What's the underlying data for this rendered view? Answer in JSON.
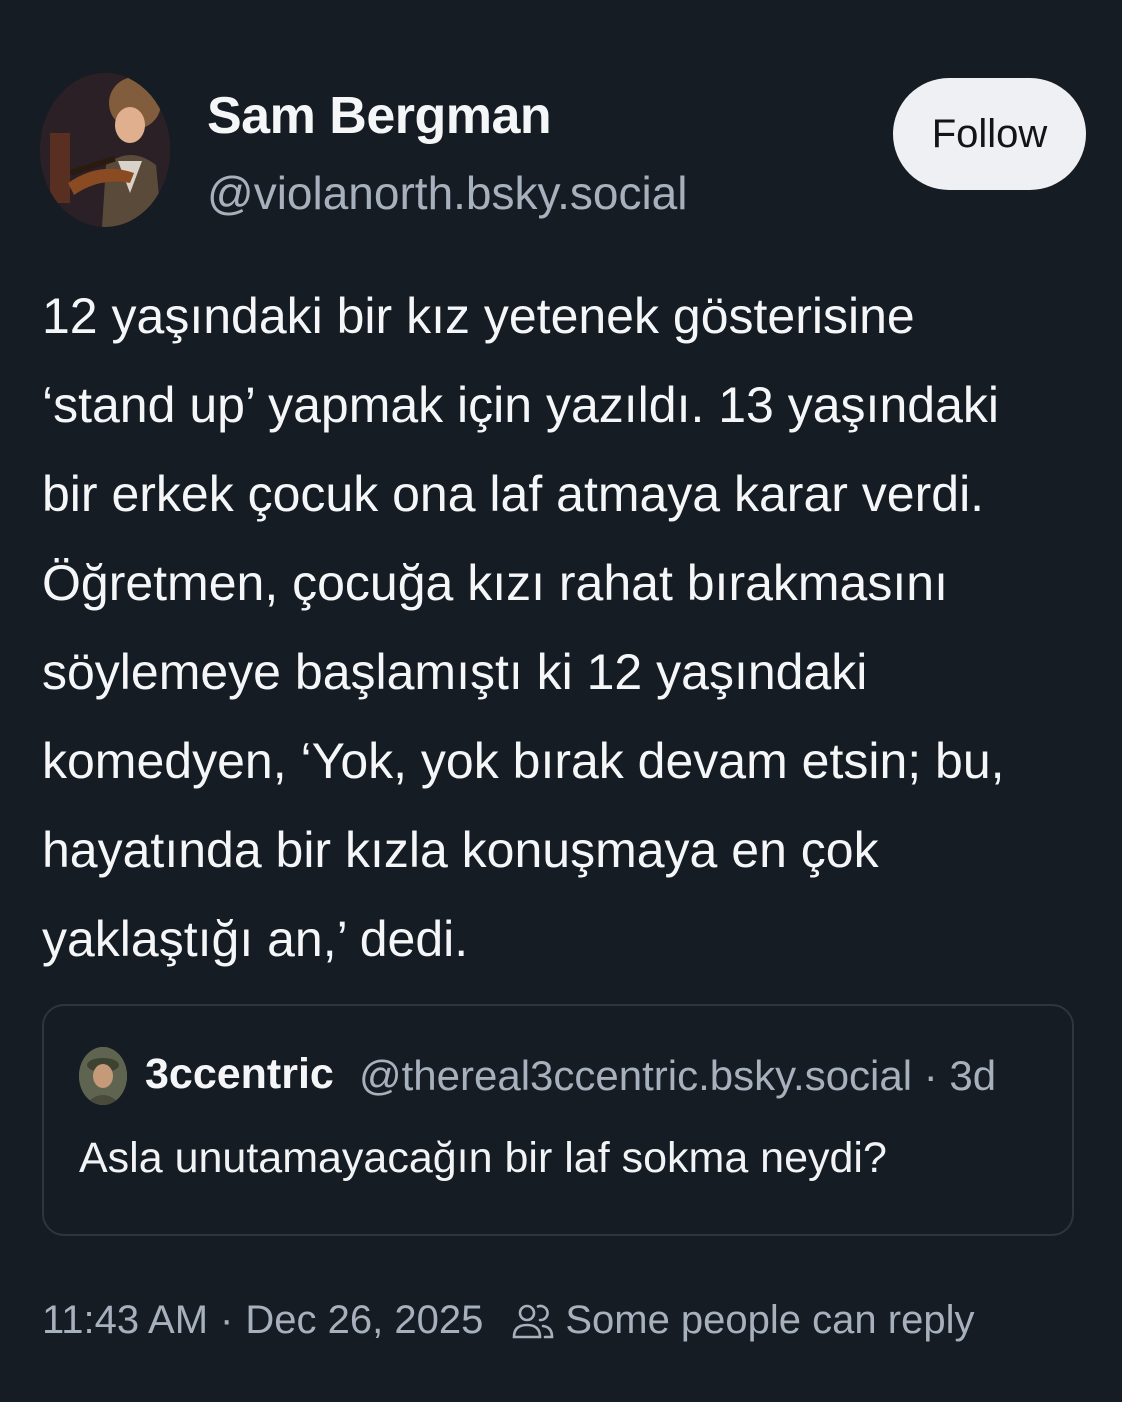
{
  "author": {
    "display_name": "Sam Bergman",
    "handle": "@violanorth.bsky.social"
  },
  "follow_label": "Follow",
  "post": {
    "lines": [
      "12 yaşındaki bir kız yetenek gösterisine",
      "‘stand up’ yapmak için yazıldı. 13 yaşındaki",
      "bir erkek çocuk ona laf atmaya karar verdi.",
      "Öğretmen, çocuğa kızı rahat bırakmasını",
      "söylemeye başlamıştı ki 12 yaşındaki",
      "komedyen, ‘Yok, yok bırak devam etsin; bu,",
      "hayatında bir kızla konuşmaya en çok",
      "yaklaştığı an,’ dedi."
    ]
  },
  "quote": {
    "author": "3ccentric",
    "handle": "@thereal3ccentric.bsky.social",
    "separator": "·",
    "age": "3d",
    "text": "Asla unutamayacağın bir laf sokma neydi?"
  },
  "footer": {
    "time": "11:43 AM",
    "separator": "·",
    "date": "Dec 26, 2025",
    "reply_setting": "Some people can reply",
    "reply_icon": "people-icon"
  },
  "colors": {
    "background": "#161c24",
    "text": "#f5f6f8",
    "muted": "#a7b1bd",
    "button_bg": "#eef0f3"
  }
}
